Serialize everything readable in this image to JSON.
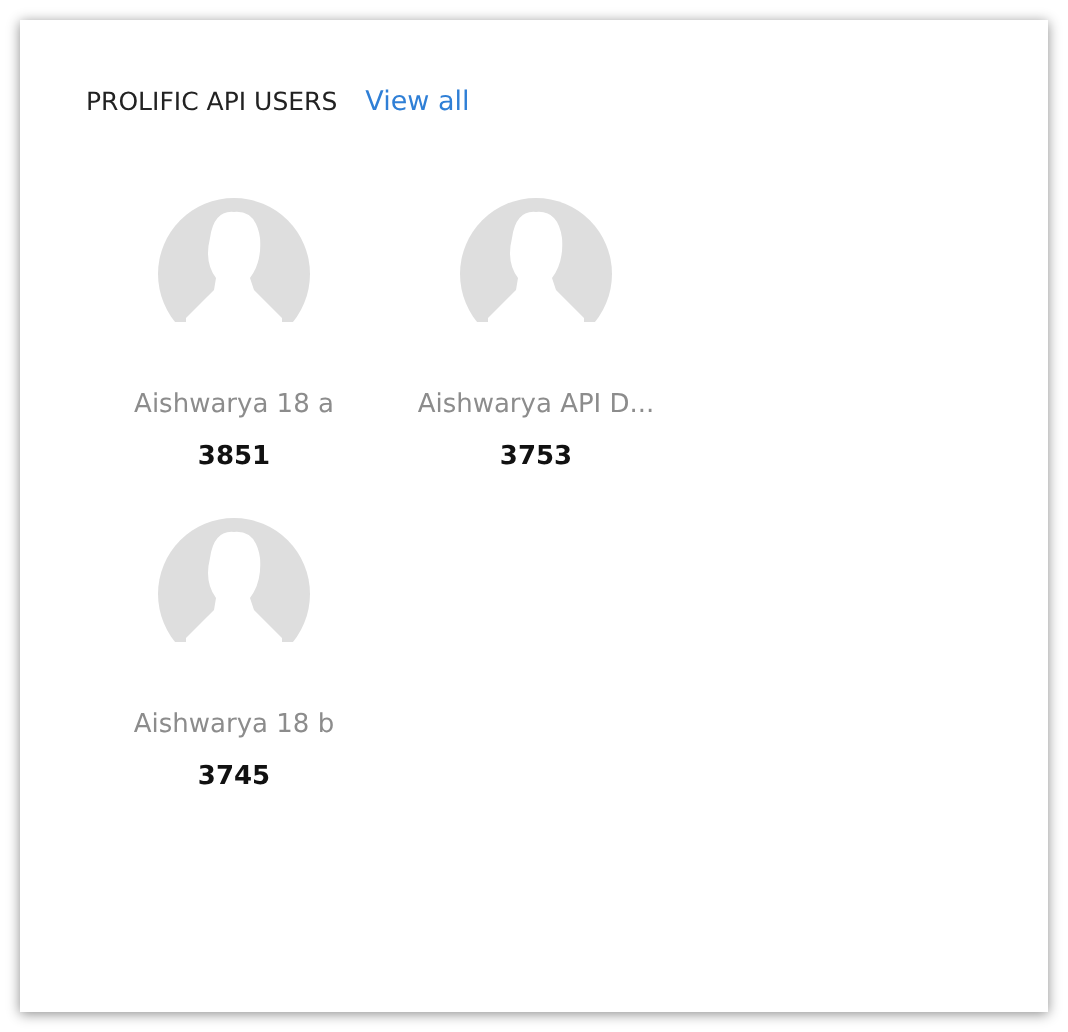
{
  "panel": {
    "title": "PROLIFIC API USERS",
    "link": "View all"
  },
  "users": [
    {
      "name": "Aishwarya 18 a",
      "count": "3851"
    },
    {
      "name": "Aishwarya API D...",
      "count": "3753"
    },
    {
      "name": "Aishwarya 18 b",
      "count": "3745"
    }
  ]
}
